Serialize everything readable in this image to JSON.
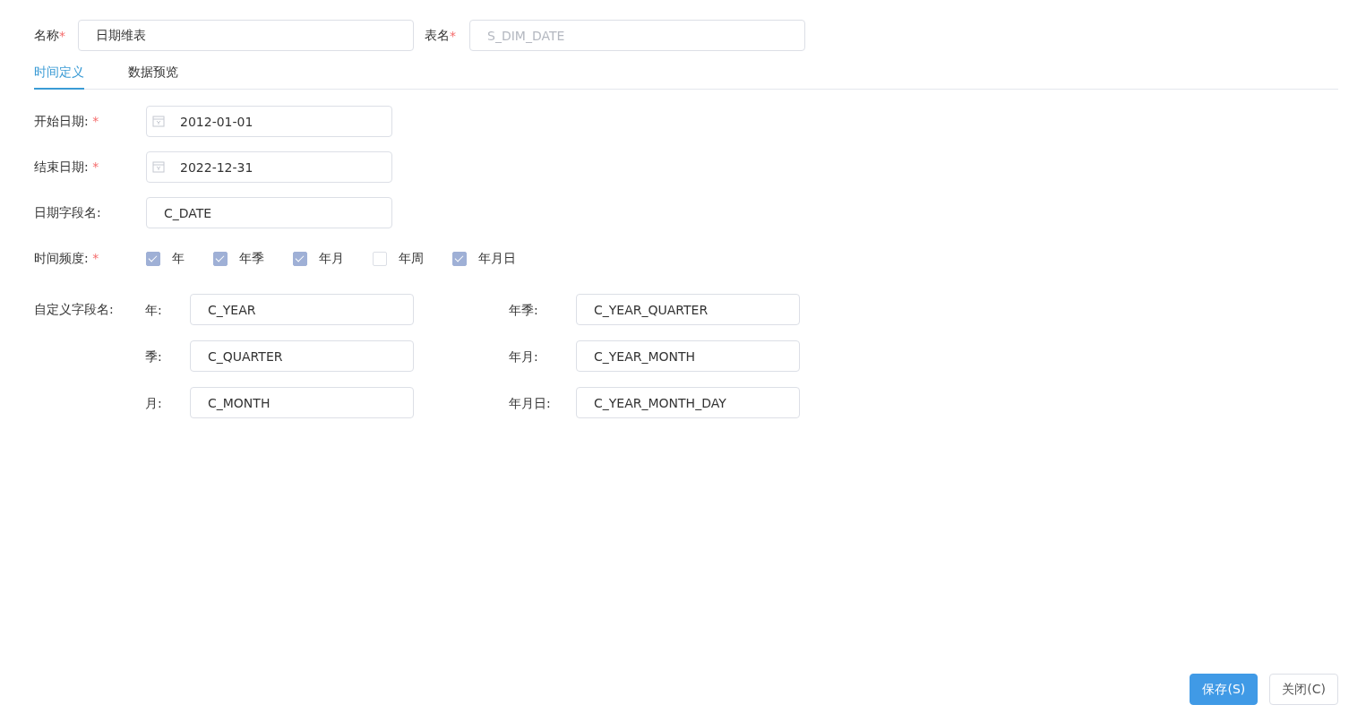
{
  "name_field": {
    "label": "名称",
    "required_mark": "*",
    "value": "日期维表",
    "disabled": false
  },
  "table_field": {
    "label": "表名",
    "required_mark": "*",
    "value": "S_DIM_DATE",
    "disabled": true
  },
  "tabs": [
    {
      "label": "时间定义",
      "selected": true
    },
    {
      "label": "数据预览",
      "selected": false
    }
  ],
  "fields": [
    {
      "kind": "date",
      "label": "开始日期:",
      "required_mark": "*",
      "value": "2012-01-01"
    },
    {
      "kind": "date",
      "label": "结束日期:",
      "required_mark": "*",
      "value": "2022-12-31"
    },
    {
      "kind": "text",
      "label": "日期字段名:",
      "value": "C_DATE"
    }
  ],
  "frequency": {
    "label": "时间频度:",
    "required_mark": "*",
    "options": [
      {
        "label": "年",
        "checked": true
      },
      {
        "label": "年季",
        "checked": true
      },
      {
        "label": "年月",
        "checked": true
      },
      {
        "label": "年周",
        "checked": false
      },
      {
        "label": "年月日",
        "checked": true
      }
    ]
  },
  "custom_fields": {
    "label": "自定义字段名:",
    "left": [
      {
        "label": "年:",
        "value": "C_YEAR"
      },
      {
        "label": "季:",
        "value": "C_QUARTER"
      },
      {
        "label": "月:",
        "value": "C_MONTH"
      }
    ],
    "right": [
      {
        "label": "年季:",
        "value": "C_YEAR_QUARTER"
      },
      {
        "label": "年月:",
        "value": "C_YEAR_MONTH"
      },
      {
        "label": "年月日:",
        "value": "C_YEAR_MONTH_DAY"
      }
    ]
  },
  "buttons": [
    {
      "label": "保存(S)",
      "kind": "primary"
    },
    {
      "label": "关闭(C)",
      "kind": "default"
    }
  ]
}
